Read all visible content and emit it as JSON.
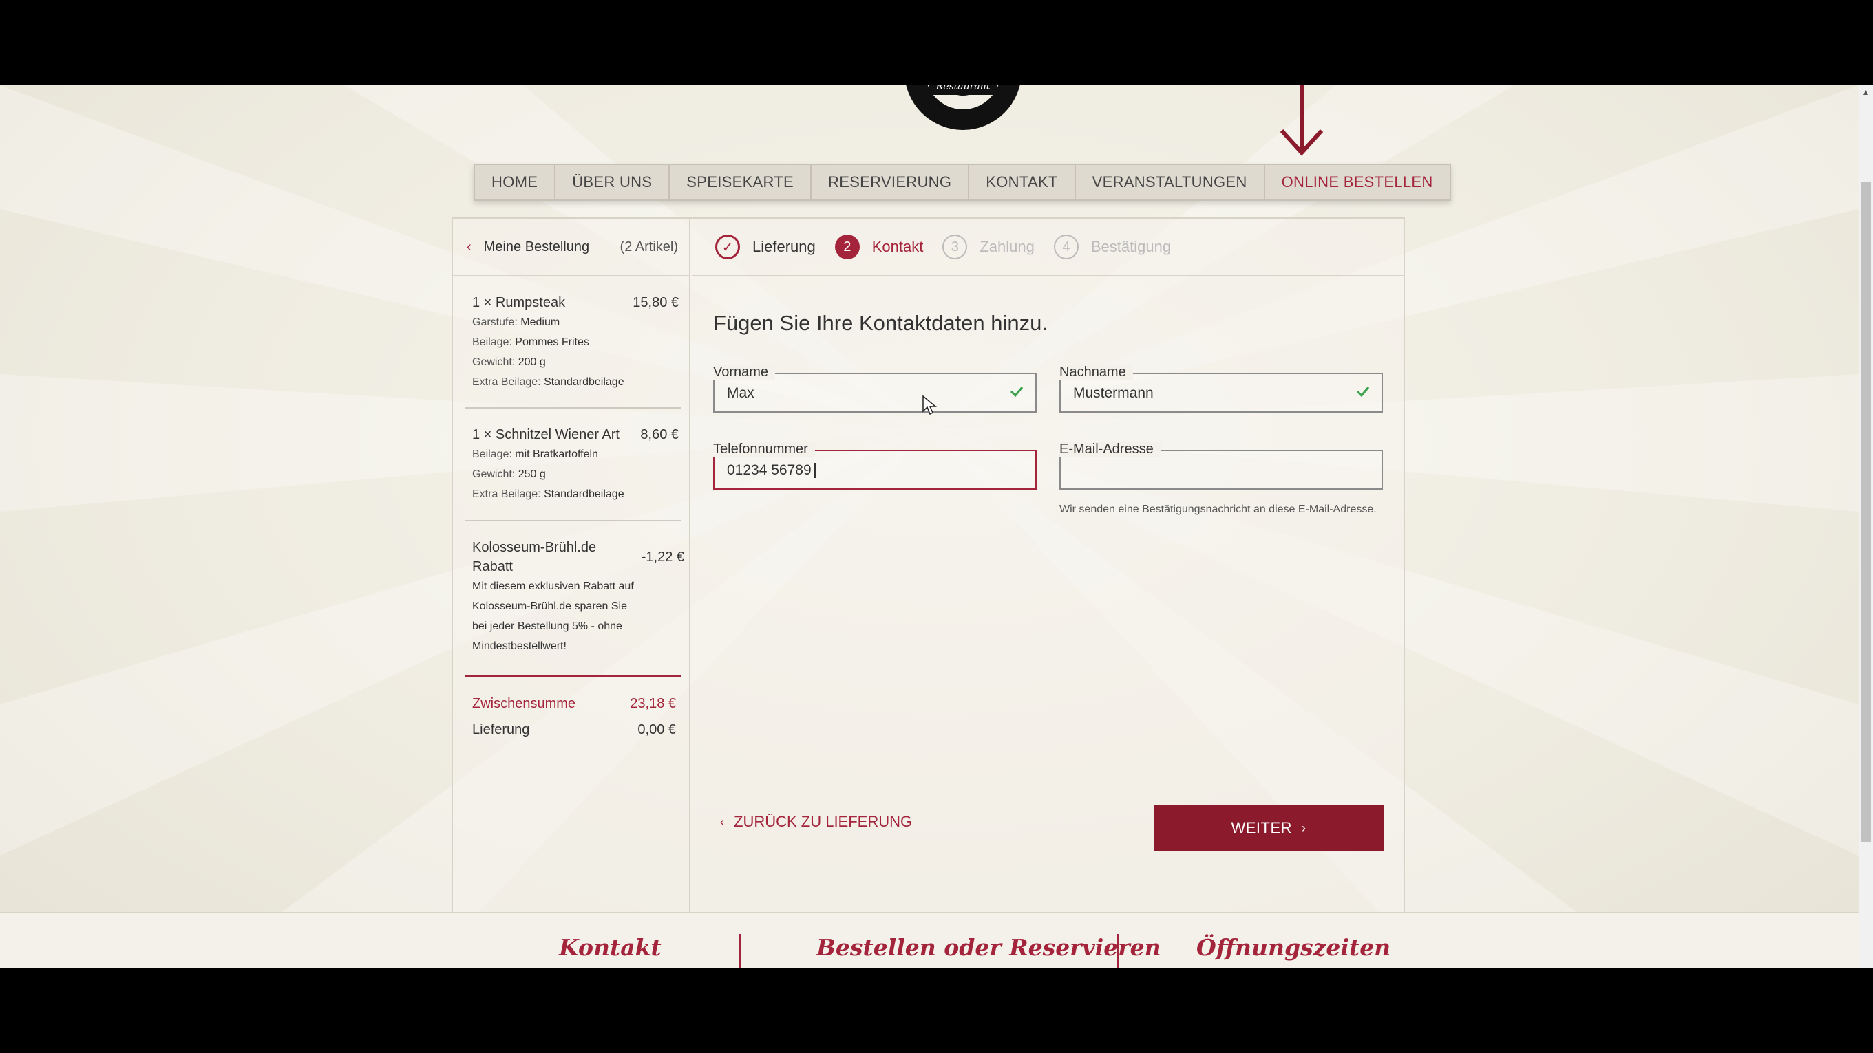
{
  "nav": {
    "items": [
      {
        "label": "HOME"
      },
      {
        "label": "ÜBER UNS"
      },
      {
        "label": "SPEISEKARTE"
      },
      {
        "label": "RESERVIERUNG"
      },
      {
        "label": "KONTAKT"
      },
      {
        "label": "VERANSTALTUNGEN"
      },
      {
        "label": "ONLINE BESTELLEN"
      }
    ]
  },
  "logo": {
    "text": "Restaurant"
  },
  "cart": {
    "title": "Meine Bestellung",
    "count": "(2 Artikel)",
    "items": [
      {
        "name": "1 × Rumpsteak",
        "price": "15,80 €",
        "details": [
          {
            "key": "Garstufe:",
            "value": "Medium"
          },
          {
            "key": "Beilage:",
            "value": "Pommes Frites"
          },
          {
            "key": "Gewicht:",
            "value": "200 g"
          },
          {
            "key": "Extra Beilage:",
            "value": "Standardbeilage"
          }
        ]
      },
      {
        "name": "1 × Schnitzel Wiener Art",
        "price": "8,60 €",
        "details": [
          {
            "key": "Beilage:",
            "value": "mit Bratkartoffeln"
          },
          {
            "key": "Gewicht:",
            "value": "250 g"
          },
          {
            "key": "Extra Beilage:",
            "value": "Standardbeilage"
          }
        ]
      }
    ],
    "discount": {
      "name_line1": "Kolosseum-Brühl.de",
      "name_line2": "Rabatt",
      "price": "-1,22 €",
      "desc": [
        "Mit diesem exklusiven Rabatt auf",
        "Kolosseum-Brühl.de sparen Sie",
        "bei jeder Bestellung 5% - ohne",
        "Mindestbestellwert!"
      ]
    },
    "subtotal_label": "Zwischensumme",
    "subtotal_value": "23,18 €",
    "delivery_label": "Lieferung",
    "delivery_value": "0,00 €"
  },
  "steps": [
    {
      "num": "✓",
      "label": "Lieferung",
      "state": "done"
    },
    {
      "num": "2",
      "label": "Kontakt",
      "state": "current"
    },
    {
      "num": "3",
      "label": "Zahlung",
      "state": "todo"
    },
    {
      "num": "4",
      "label": "Bestätigung",
      "state": "todo"
    }
  ],
  "form": {
    "title": "Fügen Sie Ihre Kontaktdaten hinzu.",
    "first_name": {
      "label": "Vorname",
      "value": "Max"
    },
    "last_name": {
      "label": "Nachname",
      "value": "Mustermann"
    },
    "phone": {
      "label": "Telefonnummer",
      "value": "01234 56789"
    },
    "email": {
      "label": "E-Mail-Adresse",
      "value": "",
      "hint": "Wir senden eine Bestätigungsnachricht an diese E-Mail-Adresse."
    },
    "back_label": "ZURÜCK ZU LIEFERUNG",
    "next_label": "WEITER"
  },
  "footer": {
    "col1": "Kontakt",
    "col2": "Bestellen oder Reservieren",
    "col3": "Öffnungszeiten"
  },
  "colors": {
    "accent": "#a4243b",
    "button": "#8a1a2c",
    "check": "#3aa14a"
  }
}
